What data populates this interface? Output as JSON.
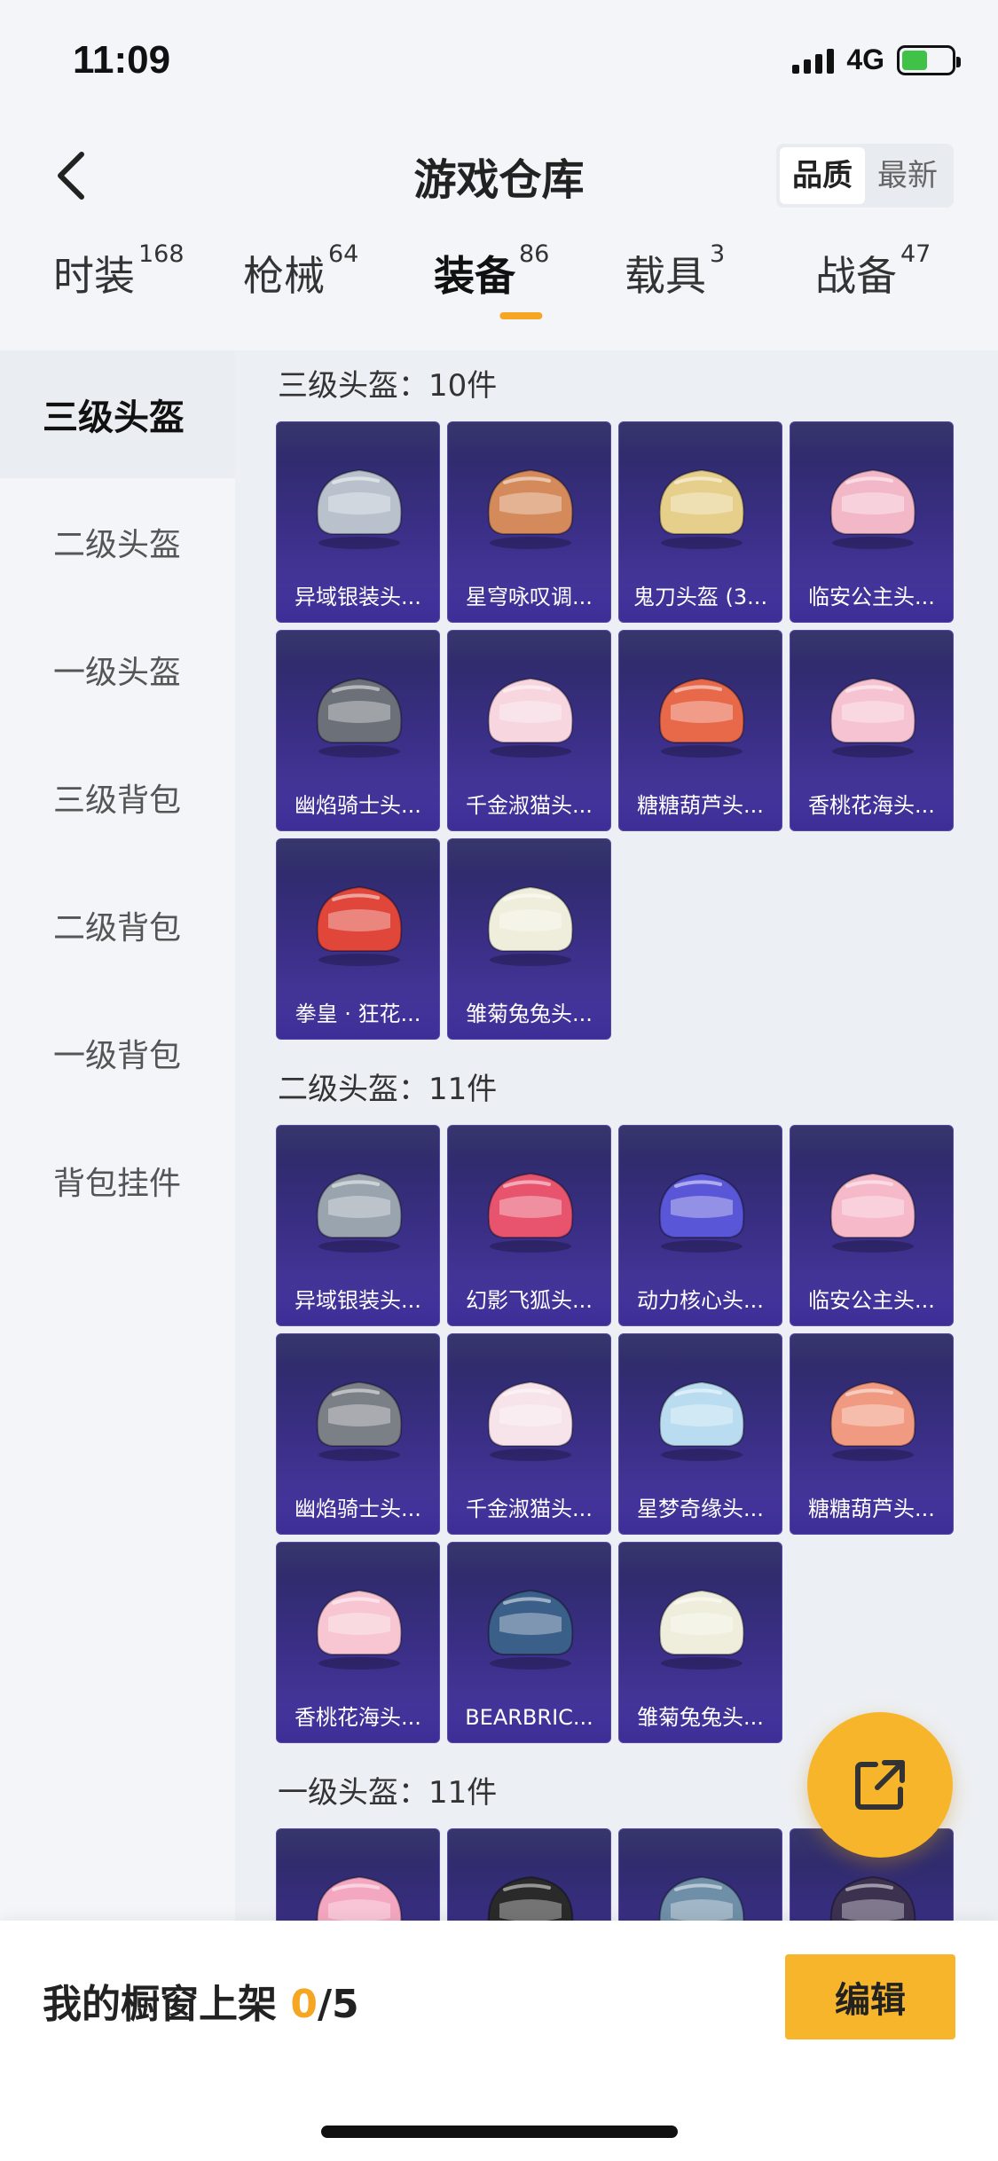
{
  "status": {
    "time": "11:09",
    "network": "4G"
  },
  "header": {
    "title": "游戏仓库",
    "sort_options": [
      "品质",
      "最新"
    ],
    "active_sort": "品质"
  },
  "tabs": [
    {
      "label": "时装",
      "count": "168"
    },
    {
      "label": "枪械",
      "count": "64"
    },
    {
      "label": "装备",
      "count": "86"
    },
    {
      "label": "载具",
      "count": "3"
    },
    {
      "label": "战备",
      "count": "47"
    }
  ],
  "active_tab": "装备",
  "sidebar": [
    "三级头盔",
    "二级头盔",
    "一级头盔",
    "三级背包",
    "二级背包",
    "一级背包",
    "背包挂件"
  ],
  "sections": [
    {
      "title": "三级头盔：10件",
      "items": [
        "异域银装头...",
        "星穹咏叹调...",
        "鬼刀头盔 (3...",
        "临安公主头...",
        "幽焰骑士头...",
        "千金淑猫头...",
        "糖糖葫芦头...",
        "香桃花海头...",
        "拳皇 · 狂花...",
        "雏菊兔兔头..."
      ]
    },
    {
      "title": "二级头盔：11件",
      "items": [
        "异域银装头...",
        "幻影飞狐头...",
        "动力核心头...",
        "临安公主头...",
        "幽焰骑士头...",
        "千金淑猫头...",
        "星梦奇缘头...",
        "糖糖葫芦头...",
        "香桃花海头...",
        "BEARBRIC...",
        "雏菊兔兔头..."
      ]
    },
    {
      "title": "一级头盔：11件",
      "items": [
        "",
        "",
        "",
        ""
      ]
    }
  ],
  "helmet_colors": {
    "sec0": [
      "#b9c2cc",
      "#d48a5a",
      "#e6cf8a",
      "#f3b8c8",
      "#6c7078",
      "#f7d6e0",
      "#e8684a",
      "#f6c3d2",
      "#e0463a",
      "#efeedc"
    ],
    "sec1": [
      "#9aa4ae",
      "#e8536e",
      "#5a56d8",
      "#f6b9c9",
      "#7b7f86",
      "#f7e3ea",
      "#b9dcf0",
      "#f19a82",
      "#f7c6d2",
      "#3a5f88",
      "#efeedc"
    ],
    "sec2": [
      "#f4a7c0",
      "#2a2a2a",
      "#6f8fa8",
      "#3c3250"
    ]
  },
  "bottom": {
    "showcase_label": "我的橱窗上架",
    "current": "0",
    "total": "/5",
    "edit_label": "编辑"
  }
}
